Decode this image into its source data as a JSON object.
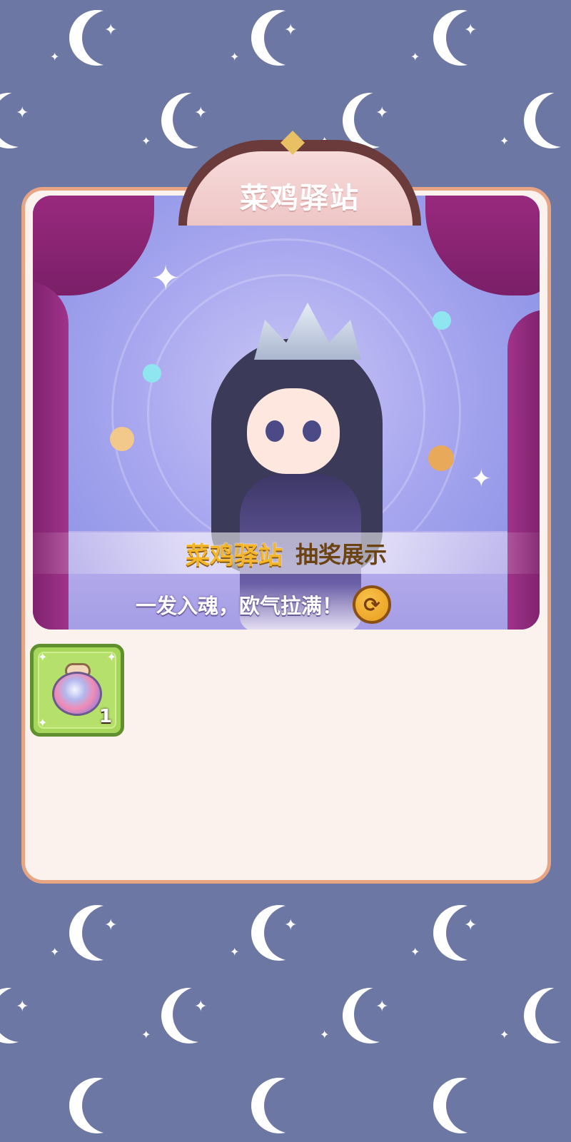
{
  "sign": {
    "title": "菜鸡驿站"
  },
  "banner": {
    "title": "菜鸡驿站",
    "subtitle": "抽奖展示",
    "tagline": "一发入魂，欧气拉满！",
    "refresh_icon": "refresh-icon"
  },
  "items": [
    {
      "icon": "potion-jar-icon",
      "count": "1"
    }
  ],
  "colors": {
    "background": "#6c77a4",
    "card": "#fbf2ee",
    "card_border": "#e8a583",
    "banner_title": "#f6b62a",
    "item_slot": "#a6d65a"
  }
}
